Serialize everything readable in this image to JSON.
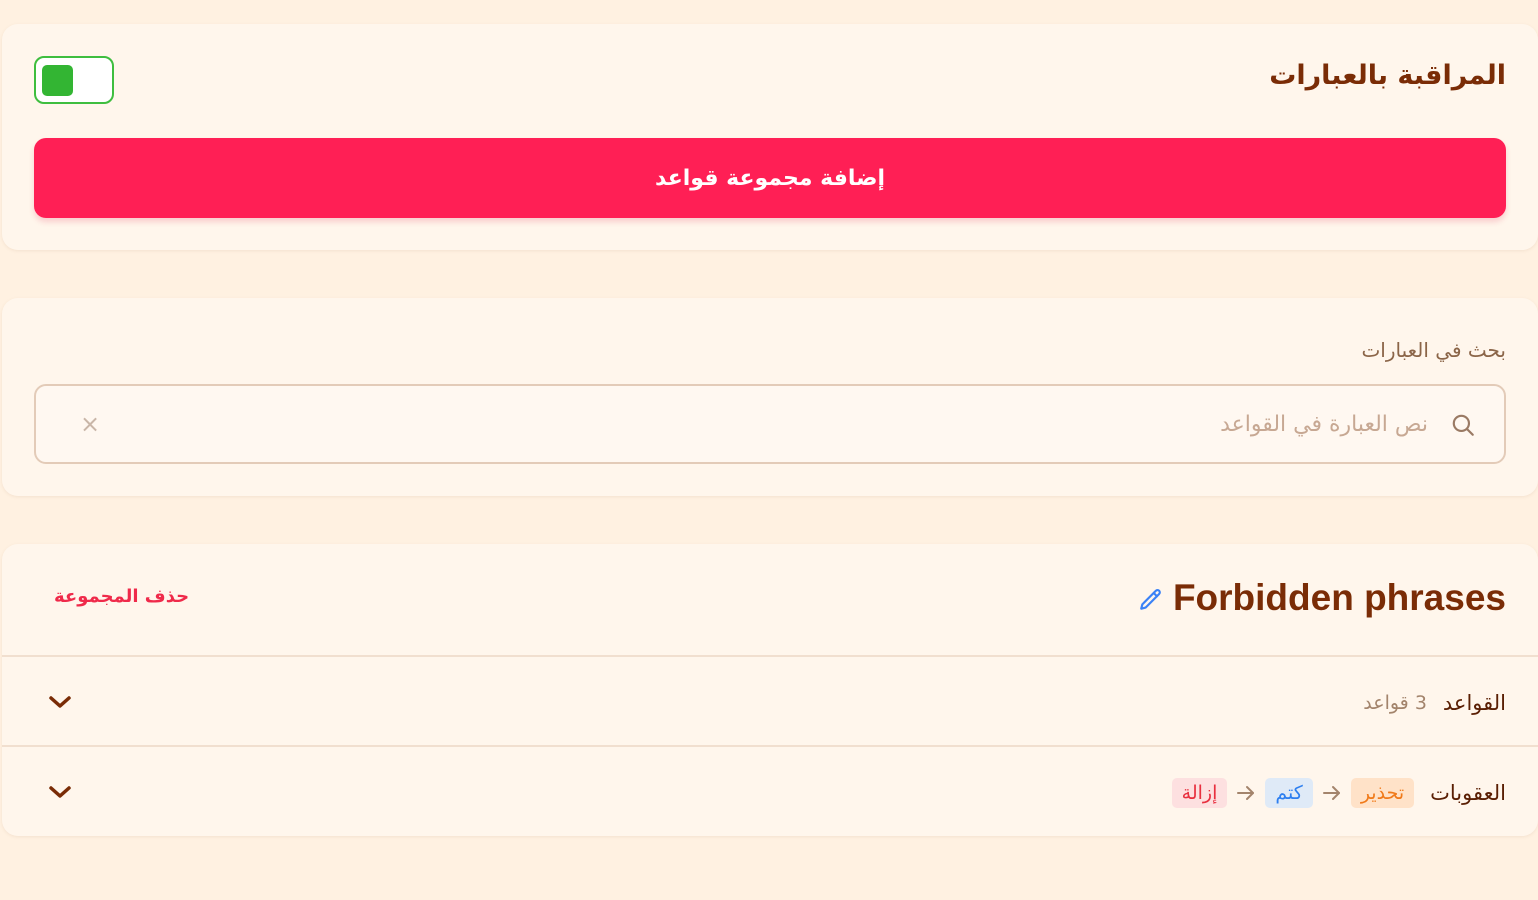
{
  "monitor_section": {
    "title": "المراقبة بالعبارات",
    "toggle_state": "on",
    "add_button_label": "إضافة مجموعة قواعد",
    "colors": {
      "accent": "#ff1f55",
      "toggle_on": "#33b533",
      "title": "#7a2c06"
    }
  },
  "search": {
    "label": "بحث في العبارات",
    "placeholder": "نص العبارة في القواعد",
    "value": "",
    "clear_symbol": "×"
  },
  "group": {
    "title": "Forbidden phrases",
    "delete_label": "حذف المجموعة",
    "rules_row": {
      "label": "القواعد",
      "count": "3 قواعد"
    },
    "penalties_row": {
      "label": "العقوبات",
      "items": [
        {
          "label": "تحذير",
          "kind": "warn",
          "color": "#f07a1a"
        },
        {
          "label": "كتم",
          "kind": "mute",
          "color": "#2d7ff0"
        },
        {
          "label": "إزالة",
          "kind": "remove",
          "color": "#e8303f"
        }
      ]
    }
  },
  "icons": {
    "search": "search-icon",
    "clear": "close-icon",
    "edit": "pencil-icon",
    "expand": "chevron-down-icon",
    "arrow": "arrow-right-icon"
  }
}
